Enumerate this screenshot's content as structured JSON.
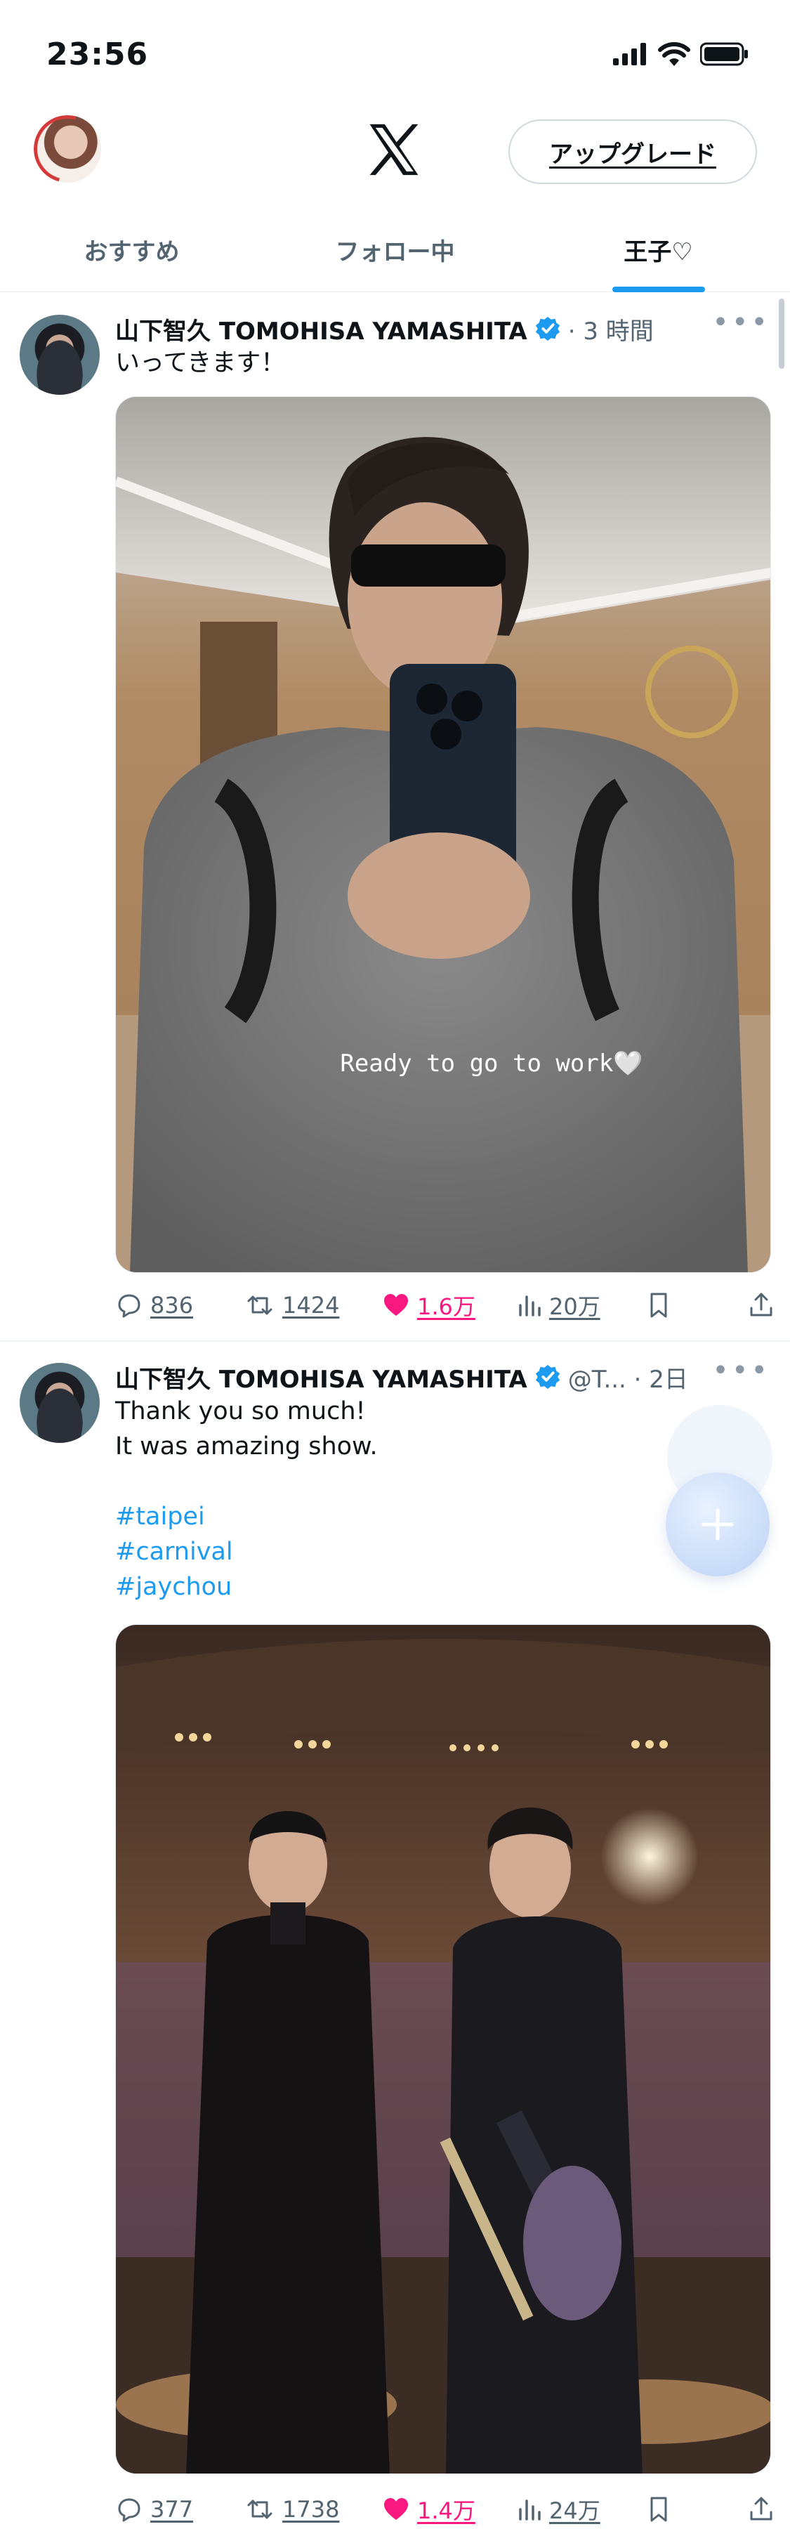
{
  "status_bar": {
    "time": "23:56"
  },
  "header": {
    "upgrade_label": "アップグレード"
  },
  "tabs": [
    {
      "label": "おすすめ",
      "active": false
    },
    {
      "label": "フォロー中",
      "active": false
    },
    {
      "label": "王子♡",
      "active": true
    }
  ],
  "posts": [
    {
      "author": "山下智久 TOMOHISA YAMASHITA",
      "meta": "· 3 時間",
      "text": "いってきます！",
      "image_caption": "Ready to go to work🤍",
      "replies": "836",
      "reposts": "1424",
      "likes": "1.6万",
      "views": "20万"
    },
    {
      "author": "山下智久 TOMOHISA YAMASHITA",
      "meta": "@T... · 2日",
      "text_lines": [
        "Thank you so much!",
        "It was amazing show."
      ],
      "hashtags": [
        "#taipei",
        "#carnival",
        "#jaychou"
      ],
      "replies": "377",
      "reposts": "1738",
      "likes": "1.4万",
      "views": "24万"
    }
  ],
  "icons": [
    "cellular-signal-icon",
    "wifi-icon",
    "battery-icon",
    "x-logo-icon",
    "verified-badge-icon",
    "more-icon",
    "reply-icon",
    "repost-icon",
    "like-icon",
    "views-icon",
    "bookmark-icon",
    "share-icon",
    "compose-plus-icon"
  ],
  "colors": {
    "accent": "#1d9bf0",
    "like": "#f91880",
    "secondary_text": "#536471"
  }
}
